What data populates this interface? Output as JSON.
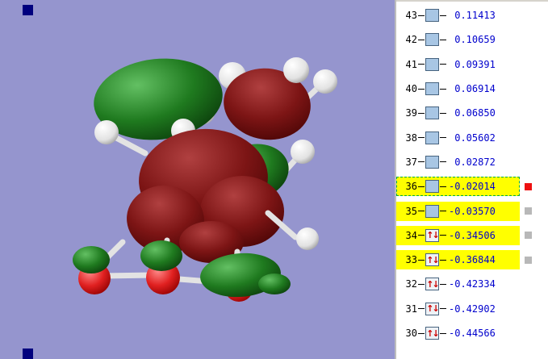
{
  "ui": {
    "viewport_bg": "#9595ce",
    "highlight_color": "#ffff00",
    "selected_row_outline_color": "#00aa44",
    "energy_text_color": "#0000cd",
    "corner_marker_color": "#00007e"
  },
  "icons": {
    "occupied_electrons": "↑↓",
    "virtual_orbital": "",
    "selected_marker": "red-square",
    "highlighted_marker": "gray-square"
  },
  "molecule": {
    "surface_positive_color": "#1f7a1f",
    "surface_negative_color": "#7d1515",
    "hydrogen_color": "#ffffff",
    "oxygen_color": "#e02020",
    "bond_color": "#e3e3e3"
  },
  "orbital_list": {
    "rows": [
      {
        "number": "43",
        "occupied": false,
        "energy": " 0.11413",
        "highlighted": false,
        "selected": false,
        "marker": ""
      },
      {
        "number": "42",
        "occupied": false,
        "energy": " 0.10659",
        "highlighted": false,
        "selected": false,
        "marker": ""
      },
      {
        "number": "41",
        "occupied": false,
        "energy": " 0.09391",
        "highlighted": false,
        "selected": false,
        "marker": ""
      },
      {
        "number": "40",
        "occupied": false,
        "energy": " 0.06914",
        "highlighted": false,
        "selected": false,
        "marker": ""
      },
      {
        "number": "39",
        "occupied": false,
        "energy": " 0.06850",
        "highlighted": false,
        "selected": false,
        "marker": ""
      },
      {
        "number": "38",
        "occupied": false,
        "energy": " 0.05602",
        "highlighted": false,
        "selected": false,
        "marker": ""
      },
      {
        "number": "37",
        "occupied": false,
        "energy": " 0.02872",
        "highlighted": false,
        "selected": false,
        "marker": ""
      },
      {
        "number": "36",
        "occupied": false,
        "energy": "-0.02014",
        "highlighted": true,
        "selected": true,
        "marker": "#ee1111"
      },
      {
        "number": "35",
        "occupied": false,
        "energy": "-0.03570",
        "highlighted": true,
        "selected": false,
        "marker": "#b8b8b8"
      },
      {
        "number": "34",
        "occupied": true,
        "energy": "-0.34506",
        "highlighted": true,
        "selected": false,
        "marker": "#b8b8b8"
      },
      {
        "number": "33",
        "occupied": true,
        "energy": "-0.36844",
        "highlighted": true,
        "selected": false,
        "marker": "#b8b8b8"
      },
      {
        "number": "32",
        "occupied": true,
        "energy": "-0.42334",
        "highlighted": false,
        "selected": false,
        "marker": ""
      },
      {
        "number": "31",
        "occupied": true,
        "energy": "-0.42902",
        "highlighted": false,
        "selected": false,
        "marker": ""
      },
      {
        "number": "30",
        "occupied": true,
        "energy": "-0.44566",
        "highlighted": false,
        "selected": false,
        "marker": ""
      }
    ]
  }
}
